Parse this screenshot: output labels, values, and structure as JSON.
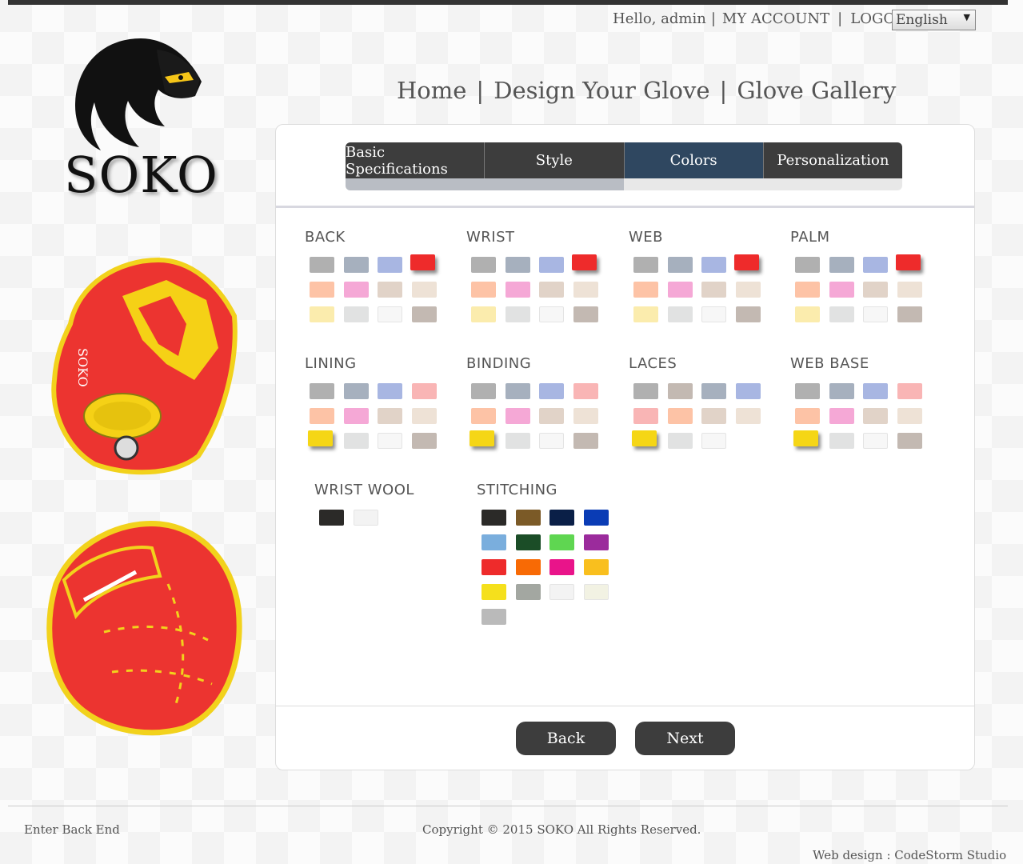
{
  "header": {
    "greeting": "Hello, admin",
    "my_account": "MY ACCOUNT",
    "logout": "LOGOUT",
    "language": "English"
  },
  "brand": {
    "name": "SOKO"
  },
  "nav": {
    "home": "Home",
    "design": "Design Your Glove",
    "gallery": "Glove Gallery"
  },
  "tabs": [
    {
      "label": "Basic Specifications"
    },
    {
      "label": "Style"
    },
    {
      "label": "Colors"
    },
    {
      "label": "Personalization"
    }
  ],
  "progress": 0.5,
  "groups": {
    "back": {
      "title": "BACK",
      "colors": [
        "#b0b0b0",
        "#a6b0be",
        "#a8b6e2",
        "#ee2b2b",
        "#fdc3a6",
        "#f5a8d6",
        "#e1d3c8",
        "#eee2d6",
        "#fbecad",
        "#e1e2e2",
        "#f7f7f7",
        "#c3b9b2"
      ],
      "selected": 3
    },
    "wrist": {
      "title": "WRIST",
      "colors": [
        "#b0b0b0",
        "#a6b0be",
        "#a8b6e2",
        "#ee2b2b",
        "#fdc3a6",
        "#f5a8d6",
        "#e1d3c8",
        "#eee2d6",
        "#fbecad",
        "#e1e2e2",
        "#f7f7f7",
        "#c3b9b2"
      ],
      "selected": 3
    },
    "web": {
      "title": "WEB",
      "colors": [
        "#b0b0b0",
        "#a6b0be",
        "#a8b6e2",
        "#ee2b2b",
        "#fdc3a6",
        "#f5a8d6",
        "#e1d3c8",
        "#eee2d6",
        "#fbecad",
        "#e1e2e2",
        "#f7f7f7",
        "#c3b9b2"
      ],
      "selected": 3
    },
    "palm": {
      "title": "PALM",
      "colors": [
        "#b0b0b0",
        "#a6b0be",
        "#a8b6e2",
        "#ee2b2b",
        "#fdc3a6",
        "#f5a8d6",
        "#e1d3c8",
        "#eee2d6",
        "#fbecad",
        "#e1e2e2",
        "#f7f7f7",
        "#c3b9b2"
      ],
      "selected": 3
    },
    "lining": {
      "title": "LINING",
      "colors": [
        "#b0b0b0",
        "#a6b0be",
        "#a8b6e2",
        "#f9b5b5",
        "#fdc3a6",
        "#f5a8d6",
        "#e1d3c8",
        "#eee2d6",
        "#f5d616",
        "#e1e2e2",
        "#f7f7f7",
        "#c3b9b2"
      ],
      "selected": 8
    },
    "binding": {
      "title": "BINDING",
      "colors": [
        "#b0b0b0",
        "#a6b0be",
        "#a8b6e2",
        "#f9b5b5",
        "#fdc3a6",
        "#f5a8d6",
        "#e1d3c8",
        "#eee2d6",
        "#f5d616",
        "#e1e2e2",
        "#f7f7f7",
        "#c3b9b2"
      ],
      "selected": 8
    },
    "laces": {
      "title": "LACES",
      "colors": [
        "#b0b0b0",
        "#c3b9b2",
        "#a6b0be",
        "#a8b6e2",
        "#f9b5b5",
        "#fdc3a6",
        "#e1d3c8",
        "#eee2d6",
        "#f5d616",
        "#e1e2e2",
        "#f7f7f7"
      ],
      "selected": 8
    },
    "webbase": {
      "title": "WEB BASE",
      "colors": [
        "#b0b0b0",
        "#a6b0be",
        "#a8b6e2",
        "#f9b5b5",
        "#fdc3a6",
        "#f5a8d6",
        "#e1d3c8",
        "#eee2d6",
        "#f5d616",
        "#e1e2e2",
        "#f7f7f7",
        "#c3b9b2"
      ],
      "selected": 8
    },
    "wristwool": {
      "title": "WRIST WOOL",
      "colors": [
        "#2b2a28",
        "#f3f3f3"
      ],
      "selected": -1
    },
    "stitching": {
      "title": "STITCHING",
      "colors": [
        "#2b2a28",
        "#7b5a27",
        "#0a1f47",
        "#0a3cb5",
        "#7aaedd",
        "#1b4d27",
        "#5fd651",
        "#9b2b9c",
        "#ee2b2b",
        "#f86a05",
        "#e9148a",
        "#f9bf1e",
        "#f5e01c",
        "#a3a7a1",
        "#f3f3f3",
        "#f2f2e3",
        "#bababa"
      ],
      "selected": -1
    }
  },
  "buttons": {
    "back": "Back",
    "next": "Next"
  },
  "footer": {
    "enter_backend": "Enter Back End",
    "copyright": "Copyright © 2015 SOKO All Rights Reserved.",
    "credit": "Web design : CodeStorm Studio"
  }
}
